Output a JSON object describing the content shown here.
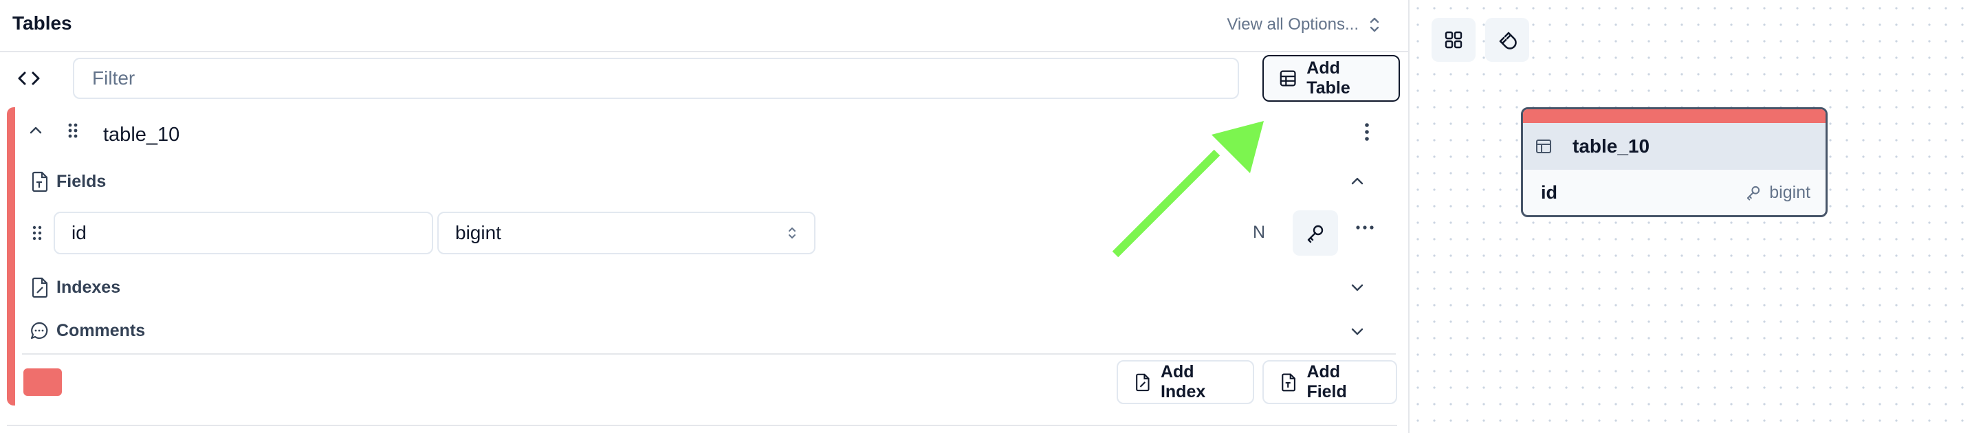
{
  "header": {
    "title": "Tables",
    "view_options_label": "View all Options..."
  },
  "toolbar": {
    "filter_placeholder": "Filter",
    "add_table_label": "Add Table"
  },
  "table_card": {
    "name": "table_10",
    "accent_color": "#ef6f6c",
    "sections": {
      "fields_label": "Fields",
      "indexes_label": "Indexes",
      "comments_label": "Comments"
    },
    "fields": [
      {
        "name": "id",
        "type": "bigint",
        "nullable_label": "N",
        "primary_key": true
      }
    ],
    "add_index_label": "Add Index",
    "add_field_label": "Add Field"
  },
  "canvas": {
    "node": {
      "title": "table_10",
      "fields": [
        {
          "name": "id",
          "type": "bigint"
        }
      ]
    }
  },
  "annotation": {
    "arrow_color": "#7cf54f"
  },
  "icons": {
    "view_options": "chevrons-up-down-icon",
    "code_toggle": "code-brackets-icon",
    "add_table": "table-grid-icon",
    "collapse": "chevron-up-icon",
    "drag": "grip-vertical-icon",
    "table_menu": "more-vertical-icon",
    "fields": "file-type-icon",
    "indexes": "file-index-icon",
    "comments": "message-circle-icon",
    "primary_key": "key-icon",
    "field_menu": "more-horizontal-icon",
    "canvas_layout": "layout-grid-icon",
    "canvas_magnet": "magnet-icon",
    "node_table": "table-icon"
  }
}
